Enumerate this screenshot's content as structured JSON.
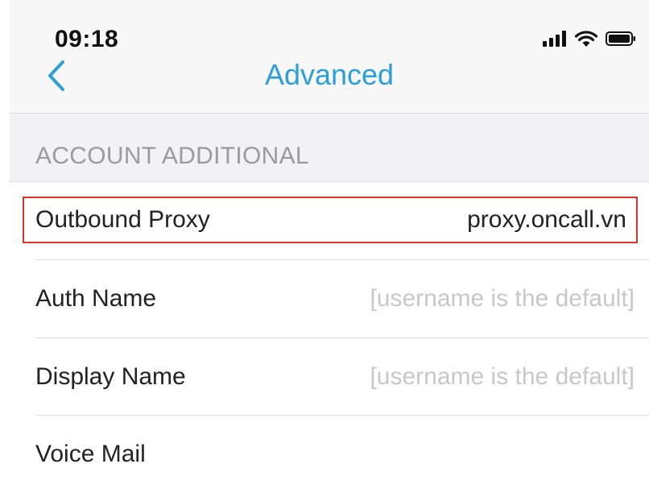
{
  "status_bar": {
    "time": "09:18",
    "icons": [
      "signal-icon",
      "wifi-icon",
      "battery-icon"
    ]
  },
  "nav": {
    "back_icon": "chevron-left-icon",
    "title": "Advanced"
  },
  "section": {
    "header": "ACCOUNT ADDITIONAL"
  },
  "rows": [
    {
      "label": "Outbound Proxy",
      "value": "proxy.oncall.vn"
    },
    {
      "label": "Auth Name",
      "placeholder": "[username is the default]"
    },
    {
      "label": "Display Name",
      "placeholder": "[username is the default]"
    },
    {
      "label": "Voice Mail",
      "value": ""
    }
  ],
  "colors": {
    "accent": "#2a9fd8",
    "highlight_border": "#e0352b",
    "placeholder": "#c7c7cc",
    "section_text": "#9b9b9b"
  }
}
